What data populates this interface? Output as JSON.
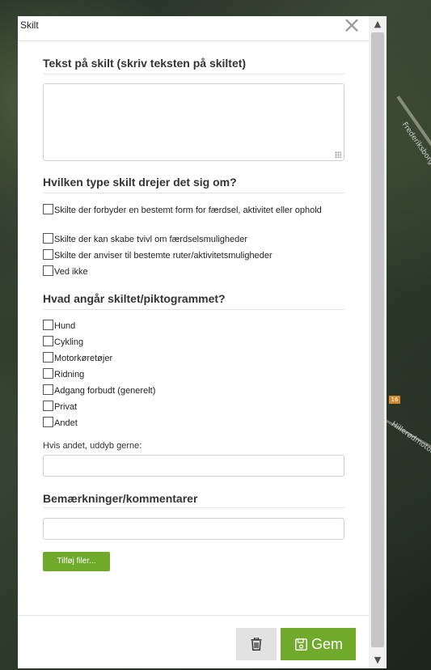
{
  "map": {
    "labels": [
      "Frederiksborgvej",
      "Hillerødmotorvej",
      "16"
    ]
  },
  "dialog": {
    "title": "Skilt",
    "close_symbol": "×"
  },
  "scrollbar": {
    "up_arrow": "▲",
    "down_arrow": "▼"
  },
  "sign_text": {
    "heading": "Tekst på skilt (skriv teksten på skiltet)",
    "value": ""
  },
  "sign_type": {
    "heading": "Hvilken type skilt drejer det sig om?",
    "options": [
      "Skilte der forbyder en bestemt form for færdsel, aktivitet eller ophold",
      "Skilte der kan skabe tvivl om færdselsmuligheder",
      "Skilte der anviser til bestemte ruter/aktivitetsmuligheder",
      "Ved ikke"
    ]
  },
  "pictogram": {
    "heading": "Hvad angår skiltet/piktogrammet?",
    "options": [
      "Hund",
      "Cykling",
      "Motorkøretøjer",
      "Ridning",
      "Adgang forbudt (generelt)",
      "Privat",
      "Andet"
    ],
    "other_label": "Hvis andet, uddyb gerne:",
    "other_value": ""
  },
  "remarks": {
    "heading": "Bemærkninger/kommentarer",
    "value": ""
  },
  "actions": {
    "add_files_label": "Tilføj filer...",
    "save_label": "Gem"
  },
  "colors": {
    "accent": "#6faa2a"
  }
}
